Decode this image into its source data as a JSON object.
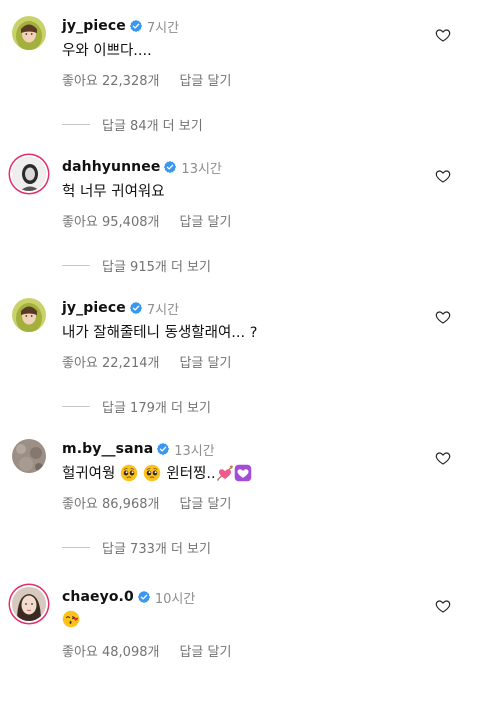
{
  "comments": [
    {
      "username": "jy_piece",
      "time": "7시간",
      "text": "우와 이쁘다....",
      "likes": "좋아요 22,328개",
      "reply_label": "답글 달기",
      "view_replies": "답글 84개 더 보기",
      "avatar": "avatar-green-hood"
    },
    {
      "username": "dahhyunnee",
      "time": "13시간",
      "text": "헉 너무 귀여워요",
      "likes": "좋아요 95,408개",
      "reply_label": "답글 달기",
      "view_replies": "답글 915개 더 보기",
      "avatar": "avatar-bw-portrait"
    },
    {
      "username": "jy_piece",
      "time": "7시간",
      "text": "내가 잘해줄테니 동생할래여... ?",
      "likes": "좋아요 22,214개",
      "reply_label": "답글 달기",
      "view_replies": "답글 179개 더 보기",
      "avatar": "avatar-green-hood"
    },
    {
      "username": "m.by__sana",
      "time": "13시간",
      "text_parts": [
        "헐귀여웡",
        "윈터찡.."
      ],
      "emojis": [
        "pleading-face",
        "pleading-face",
        "heart-with-arrow",
        "purple-heart"
      ],
      "likes": "좋아요 86,968개",
      "reply_label": "답글 달기",
      "view_replies": "답글 733개 더 보기",
      "avatar": "avatar-texture"
    },
    {
      "username": "chaeyo.0",
      "time": "10시간",
      "emojis": [
        "kissing-heart-face"
      ],
      "likes": "좋아요 48,098개",
      "reply_label": "답글 달기",
      "avatar": "avatar-face"
    }
  ],
  "colors": {
    "verified": "#3897f0",
    "muted": "#737373",
    "story_ring": "#e1306c"
  }
}
